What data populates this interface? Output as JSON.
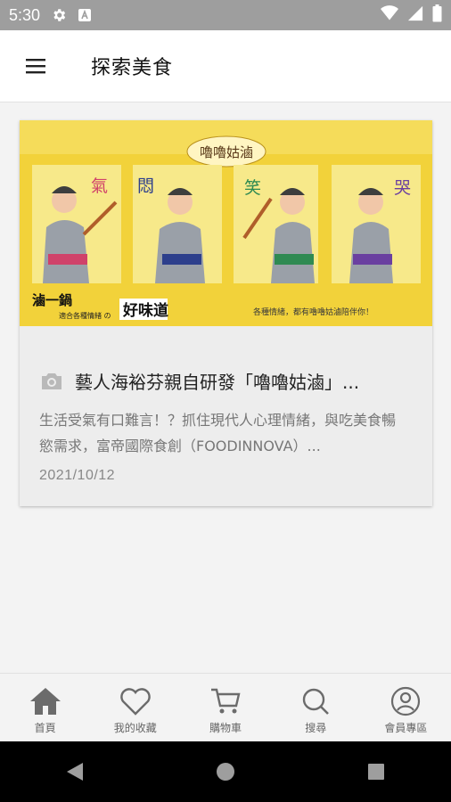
{
  "status_bar": {
    "time": "5:30"
  },
  "app_bar": {
    "title": "探索美食"
  },
  "article": {
    "title": "藝人海裕芬親自研發「嚕嚕姑滷」...",
    "description": "生活受氣有口難言！？抓住現代人心理情緒，與吃美食暢慾需求，富帝國際食創（FOODINNOVA）...",
    "date": "2021/10/12",
    "banner": {
      "logo_text": "嚕嚕姑滷",
      "moods": [
        "氣",
        "悶",
        "笑",
        "哭"
      ],
      "tagline_big": "滷一鍋",
      "tagline_small": "適合各種情緒 の",
      "tagline_highlight": "好味道",
      "slogan": "各種情緒，都有嚕嚕姑滷陪伴你！"
    }
  },
  "bottom_nav": [
    {
      "label": "首頁",
      "icon": "home-icon"
    },
    {
      "label": "我的收藏",
      "icon": "heart-icon"
    },
    {
      "label": "購物車",
      "icon": "cart-icon"
    },
    {
      "label": "搜尋",
      "icon": "search-icon"
    },
    {
      "label": "會員專區",
      "icon": "account-icon"
    }
  ],
  "colors": {
    "accent": "#666666",
    "banner_yellow": "#f2d23a",
    "status_bar": "#9e9e9e"
  }
}
